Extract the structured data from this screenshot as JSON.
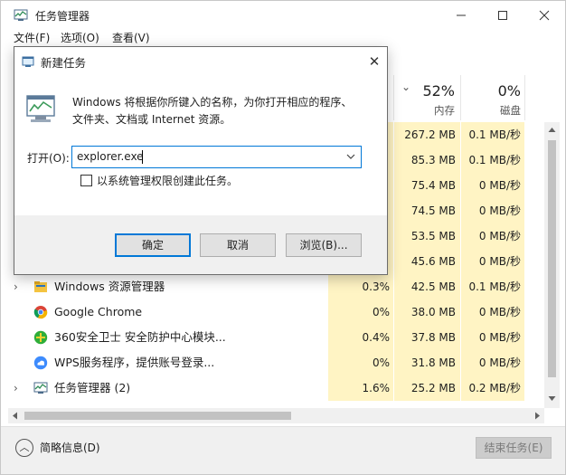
{
  "window": {
    "title": "任务管理器",
    "controls": {
      "minimize": "—",
      "maximize": "☐",
      "close": "✕"
    }
  },
  "menu": [
    {
      "label": "文件(F)"
    },
    {
      "label": "选项(O)"
    },
    {
      "label": "查看(V)"
    }
  ],
  "columns": {
    "sort_arrow": "⌄",
    "memory": {
      "percent": "52%",
      "label": "内存"
    },
    "disk": {
      "percent": "0%",
      "label": "磁盘"
    }
  },
  "rows": [
    {
      "name": "",
      "cpu": "",
      "memory": "267.2 MB",
      "disk": "0.1 MB/秒"
    },
    {
      "name": "",
      "cpu": "",
      "memory": "85.3 MB",
      "disk": "0.1 MB/秒"
    },
    {
      "name": "",
      "cpu": "",
      "memory": "75.4 MB",
      "disk": "0 MB/秒"
    },
    {
      "name": "",
      "cpu": "",
      "memory": "74.5 MB",
      "disk": "0 MB/秒"
    },
    {
      "name": "",
      "cpu": "",
      "memory": "53.5 MB",
      "disk": "0 MB/秒"
    },
    {
      "name": "",
      "cpu": "",
      "memory": "45.6 MB",
      "disk": "0 MB/秒"
    },
    {
      "name": "Windows 资源管理器",
      "cpu": "0.3%",
      "memory": "42.5 MB",
      "disk": "0.1 MB/秒",
      "expandable": true,
      "icon": "folder-icon"
    },
    {
      "name": "Google Chrome",
      "cpu": "0%",
      "memory": "38.0 MB",
      "disk": "0 MB/秒",
      "expandable": false,
      "icon": "chrome-icon"
    },
    {
      "name": "360安全卫士 安全防护中心模块...",
      "cpu": "0.4%",
      "memory": "37.8 MB",
      "disk": "0 MB/秒",
      "expandable": false,
      "icon": "360-icon"
    },
    {
      "name": "WPS服务程序，提供账号登录...",
      "cpu": "0%",
      "memory": "31.8 MB",
      "disk": "0 MB/秒",
      "expandable": false,
      "icon": "wps-cloud-icon"
    },
    {
      "name": "任务管理器 (2)",
      "cpu": "1.6%",
      "memory": "25.2 MB",
      "disk": "0.2 MB/秒",
      "expandable": true,
      "icon": "task-manager-icon"
    }
  ],
  "footer": {
    "toggle_icon": "︿",
    "toggle_label": "简略信息(D)",
    "end_task": "结束任务(E)"
  },
  "dialog": {
    "title": "新建任务",
    "close": "✕",
    "description_line1": "Windows 将根据你所键入的名称，为你打开相应的程序、",
    "description_line2": "文件夹、文档或 Internet 资源。",
    "open_label": "打开(O):",
    "input_value": "explorer.exe",
    "checkbox_label": "以系统管理权限创建此任务。",
    "checkbox_checked": false,
    "ok": "确定",
    "cancel": "取消",
    "browse": "浏览(B)..."
  },
  "colors": {
    "highlight": "#fff4c4",
    "accent": "#0078d7",
    "footer_bg": "#f0f0f0"
  }
}
